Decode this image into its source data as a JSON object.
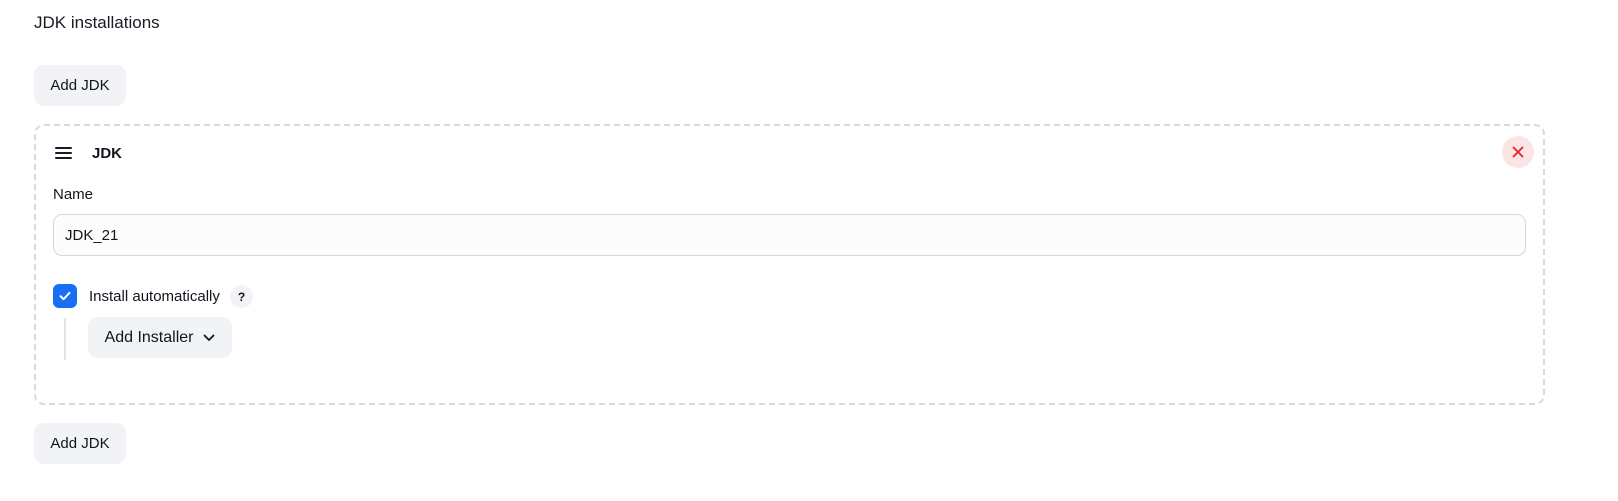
{
  "section": {
    "title": "JDK installations"
  },
  "buttons": {
    "add_jdk_top": "Add JDK",
    "add_jdk_bottom": "Add JDK"
  },
  "jdk_card": {
    "title": "JDK",
    "name_label": "Name",
    "name_value": "JDK_21",
    "install_automatically": {
      "label": "Install automatically",
      "checked": true,
      "help_glyph": "?"
    },
    "add_installer_label": "Add Installer"
  },
  "icons": {
    "drag_handle": "drag-handle-icon",
    "close": "close-icon",
    "check": "check-icon",
    "chevron": "chevron-down-icon"
  },
  "colors": {
    "accent": "#1a6ef5",
    "danger": "#e0262b",
    "danger_bg": "#fde4e4",
    "button_bg": "#f1f3f6"
  }
}
